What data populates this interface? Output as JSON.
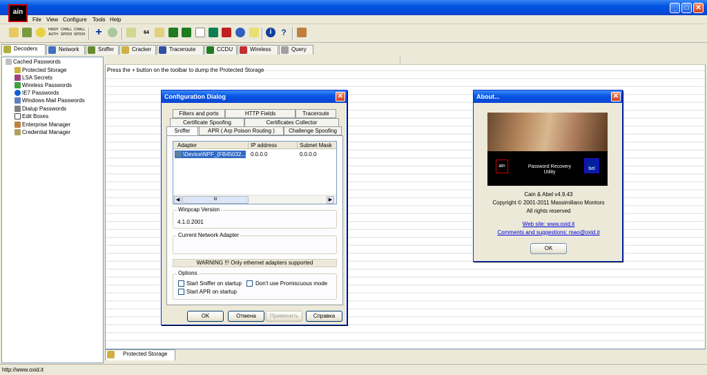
{
  "window": {
    "minimize": "_",
    "maximize": "□",
    "close": "✕"
  },
  "app_icon_text": "ain",
  "menu": [
    "File",
    "View",
    "Configure",
    "Tools",
    "Help"
  ],
  "toolbar": {
    "hash_auth": "HASH AUTH",
    "chall_spoof_reset": "CHALL SPOOF RESET",
    "chall_spoof_ntlm": "CHALL SPOOF NTLM",
    "base64": "64"
  },
  "tabs": [
    "Decoders",
    "Network",
    "Sniffer",
    "Cracker",
    "Traceroute",
    "CCDU",
    "Wireless",
    "Query"
  ],
  "tree": [
    "Cached Passwords",
    "Protected Storage",
    "LSA Secrets",
    "Wireless Passwords",
    "IE7 Passwords",
    "Windows Mail Passwords",
    "Dialup Passwords",
    "Edit Boxes",
    "Enterprise Manager",
    "Credential Manager"
  ],
  "main": {
    "info": "Press the + button on the toolbar to dump the Protected Storage"
  },
  "bottom_tab": "Protected Storage",
  "status": "http://www.oxid.it",
  "config": {
    "title": "Configuration Dialog",
    "tabs_row1": [
      "Filters and ports",
      "HTTP Fields",
      "Traceroute"
    ],
    "tabs_row2": [
      "Certificate Spoofing",
      "Certificates Collector"
    ],
    "tabs_row3": [
      "Sniffer",
      "APR ( Arp Poison Routing )",
      "Challenge Spoofing"
    ],
    "columns": [
      "Adapter",
      "IP address",
      "Subnet Mask"
    ],
    "rows": [
      [
        "\\Device\\NPF_{FB45032...",
        "0.0.0.0",
        "0.0.0.0"
      ]
    ],
    "scroll_grip": "III",
    "winpcap_label": "Winpcap Version",
    "winpcap_value": "4.1.0.2001",
    "current_adapter_label": "Current Network Adapter",
    "warning": "WARNING !!! Only ethernet adapters supported",
    "options_label": "Options",
    "opt_sniffer": "Start Sniffer on startup",
    "opt_apr": "Start APR on startup",
    "opt_promisc": "Don't use Promiscuous mode",
    "ok": "OK",
    "cancel": "Отмена",
    "apply": "Применить",
    "help": "Справка"
  },
  "about": {
    "title": "About...",
    "banner_left": "ain",
    "banner_text1": "Password Recovery",
    "banner_text2": "Utility",
    "banner_right": "bel",
    "version": "Cain & Abel v4.9.43",
    "copyright": "Copyright © 2001-2011 Massimiliano Montoro",
    "rights": "All rights reserved",
    "website": "Web site: www.oxid.it",
    "comments": "Comments and suggestions: mao@oxid.it",
    "ok": "OK"
  }
}
